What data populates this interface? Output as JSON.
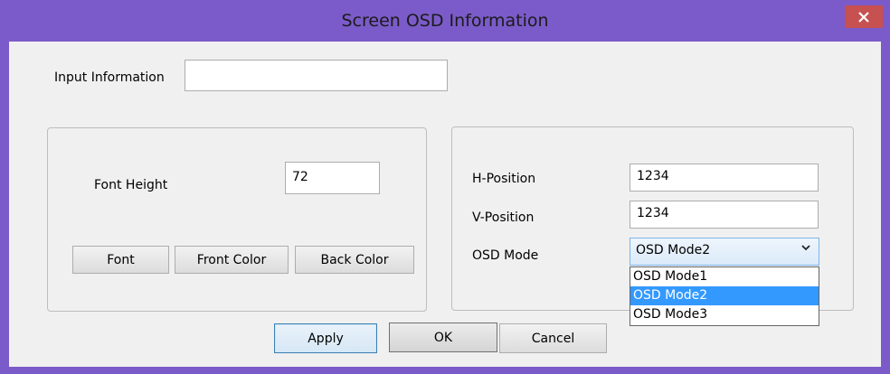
{
  "window": {
    "title": "Screen OSD Information",
    "close_glyph": "✕"
  },
  "input_info": {
    "label": "Input Information",
    "value": ""
  },
  "left_group": {
    "font_height_label": "Font Height",
    "font_height_value": "72",
    "font_button": "Font",
    "front_color_button": "Front Color",
    "back_color_button": "Back Color"
  },
  "right_group": {
    "h_position_label": "H-Position",
    "h_position_value": "1234",
    "v_position_label": "V-Position",
    "v_position_value": "1234",
    "osd_mode_label": "OSD Mode",
    "osd_mode_selected": "OSD Mode2",
    "osd_mode_options": [
      "OSD Mode1",
      "OSD Mode2",
      "OSD Mode3"
    ]
  },
  "footer": {
    "apply": "Apply",
    "ok": "OK",
    "cancel": "Cancel"
  },
  "colors": {
    "frame": "#7b5bc9",
    "close": "#c75050",
    "selection": "#3399ff"
  }
}
